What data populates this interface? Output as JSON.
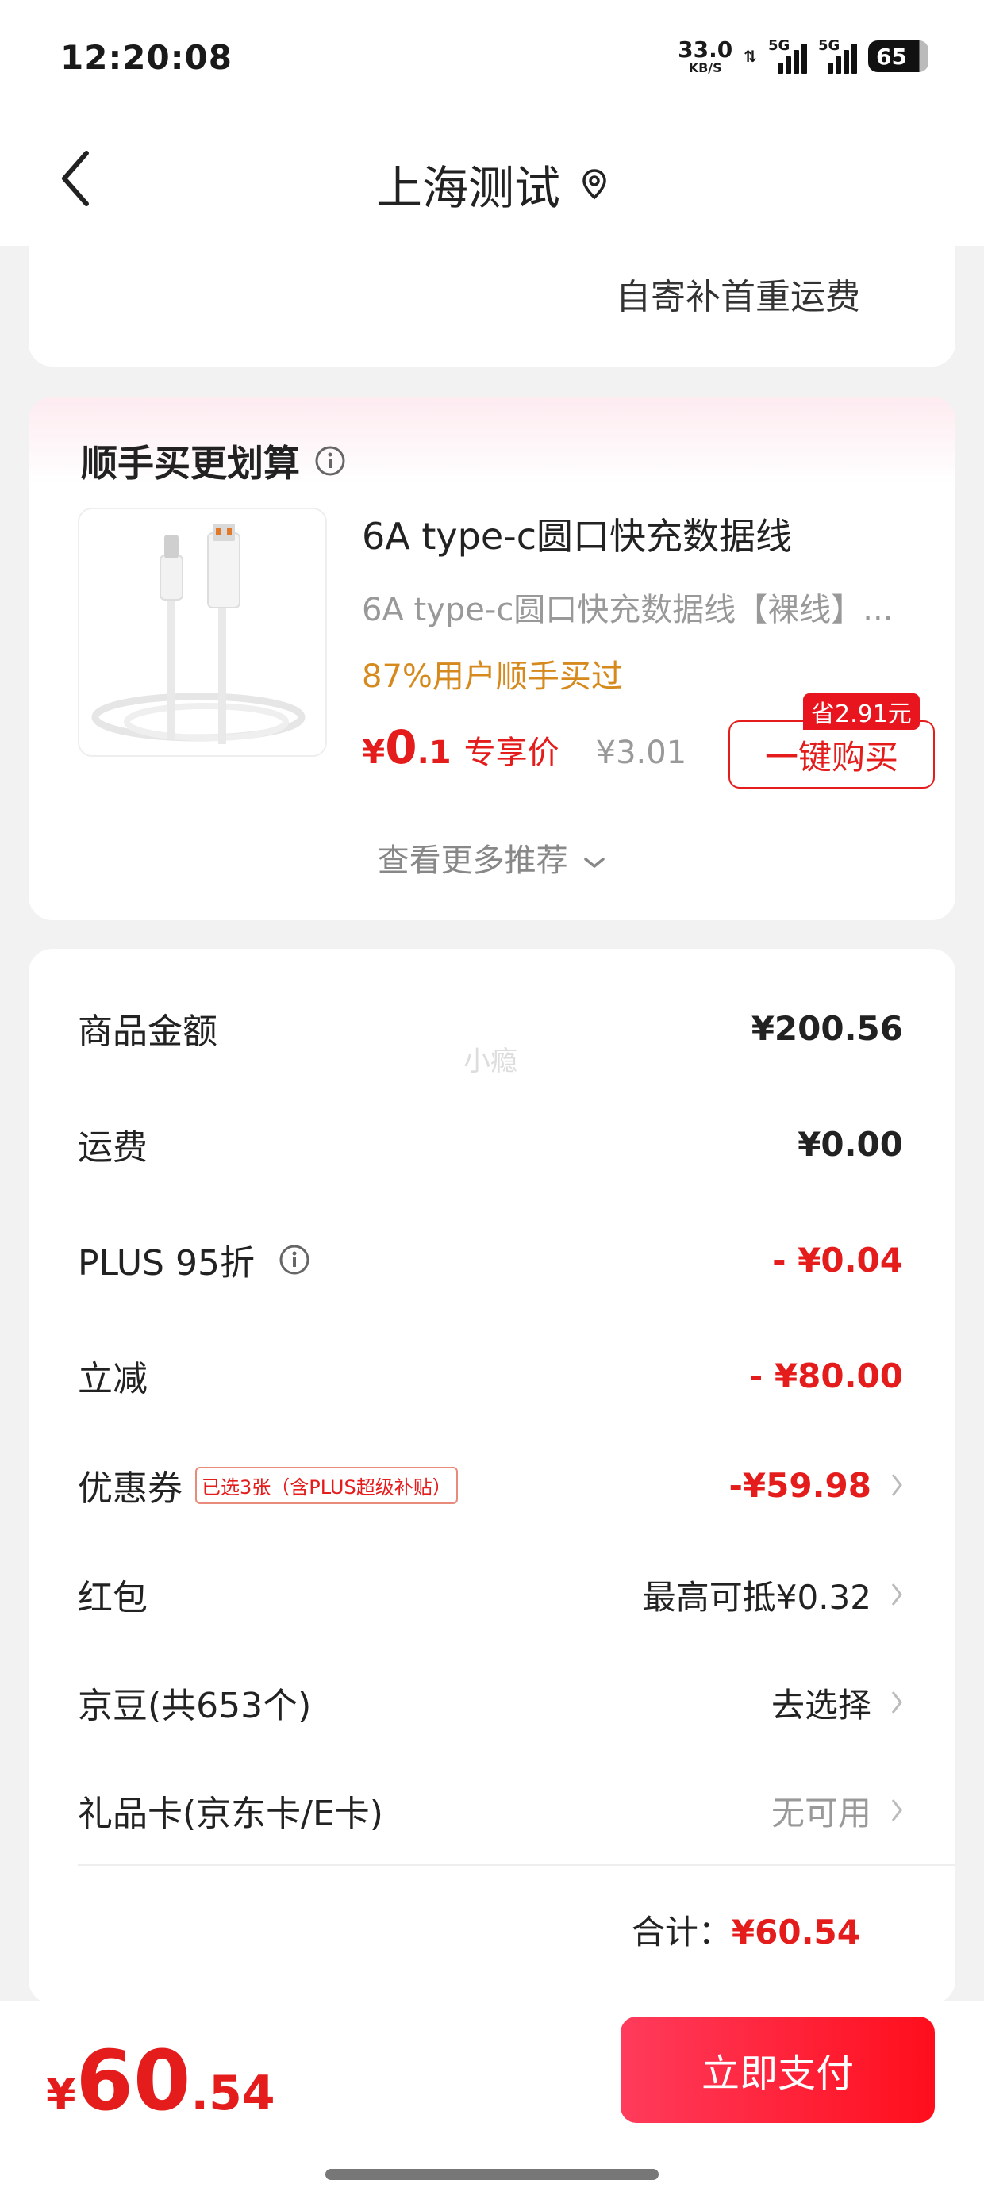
{
  "status_bar": {
    "time": "12:20:08",
    "net_speed": "33.0",
    "net_unit": "KB/S",
    "net_arrows": "⇅",
    "sim1": "5G",
    "sim2": "5G",
    "battery": "65"
  },
  "header": {
    "back_icon": "chevron-left-icon",
    "title": "上海测试",
    "location_icon": "location-pin-icon"
  },
  "shipping": {
    "self_ship_note": "自寄补首重运费"
  },
  "recommend": {
    "title": "顺手买更划算",
    "product": {
      "image_icon": "usb-cable-image",
      "name": "6A type-c圆口快充数据线",
      "subtitle": "6A type-c圆口快充数据线【裸线】...",
      "social_proof": "87%用户顺手买过",
      "price_currency": "¥",
      "price_int": "0",
      "price_dec": ".1",
      "exclusive_label": "专享价",
      "original_price": "¥3.01",
      "save_tag": "省2.91元",
      "buy_button": "一键购买"
    },
    "more_label": "查看更多推荐"
  },
  "summary": {
    "watermark": "小瘾",
    "rows": [
      {
        "label": "商品金额",
        "value": "¥200.56"
      },
      {
        "label": "运费",
        "value": "¥0.00"
      },
      {
        "label": "PLUS 95折",
        "value": "- ¥0.04"
      },
      {
        "label": "立减",
        "value": "- ¥80.00"
      },
      {
        "label": "优惠券",
        "tag": "已选3张（含PLUS超级补贴）",
        "value": "-¥59.98"
      },
      {
        "label": "红包",
        "value": "最高可抵¥0.32"
      },
      {
        "label": "京豆(共653个)",
        "value": "去选择"
      },
      {
        "label": "礼品卡(京东卡/E卡)",
        "value": "无可用"
      }
    ],
    "total_label": "合计：",
    "total_value": "¥60.54"
  },
  "bottom": {
    "price_currency": "¥",
    "price_int": "60",
    "price_dec": ".54",
    "pay_button": "立即支付"
  },
  "colors": {
    "accent_red": "#e41c1c",
    "orange": "#d68a1e",
    "background": "#f2f2f2"
  }
}
